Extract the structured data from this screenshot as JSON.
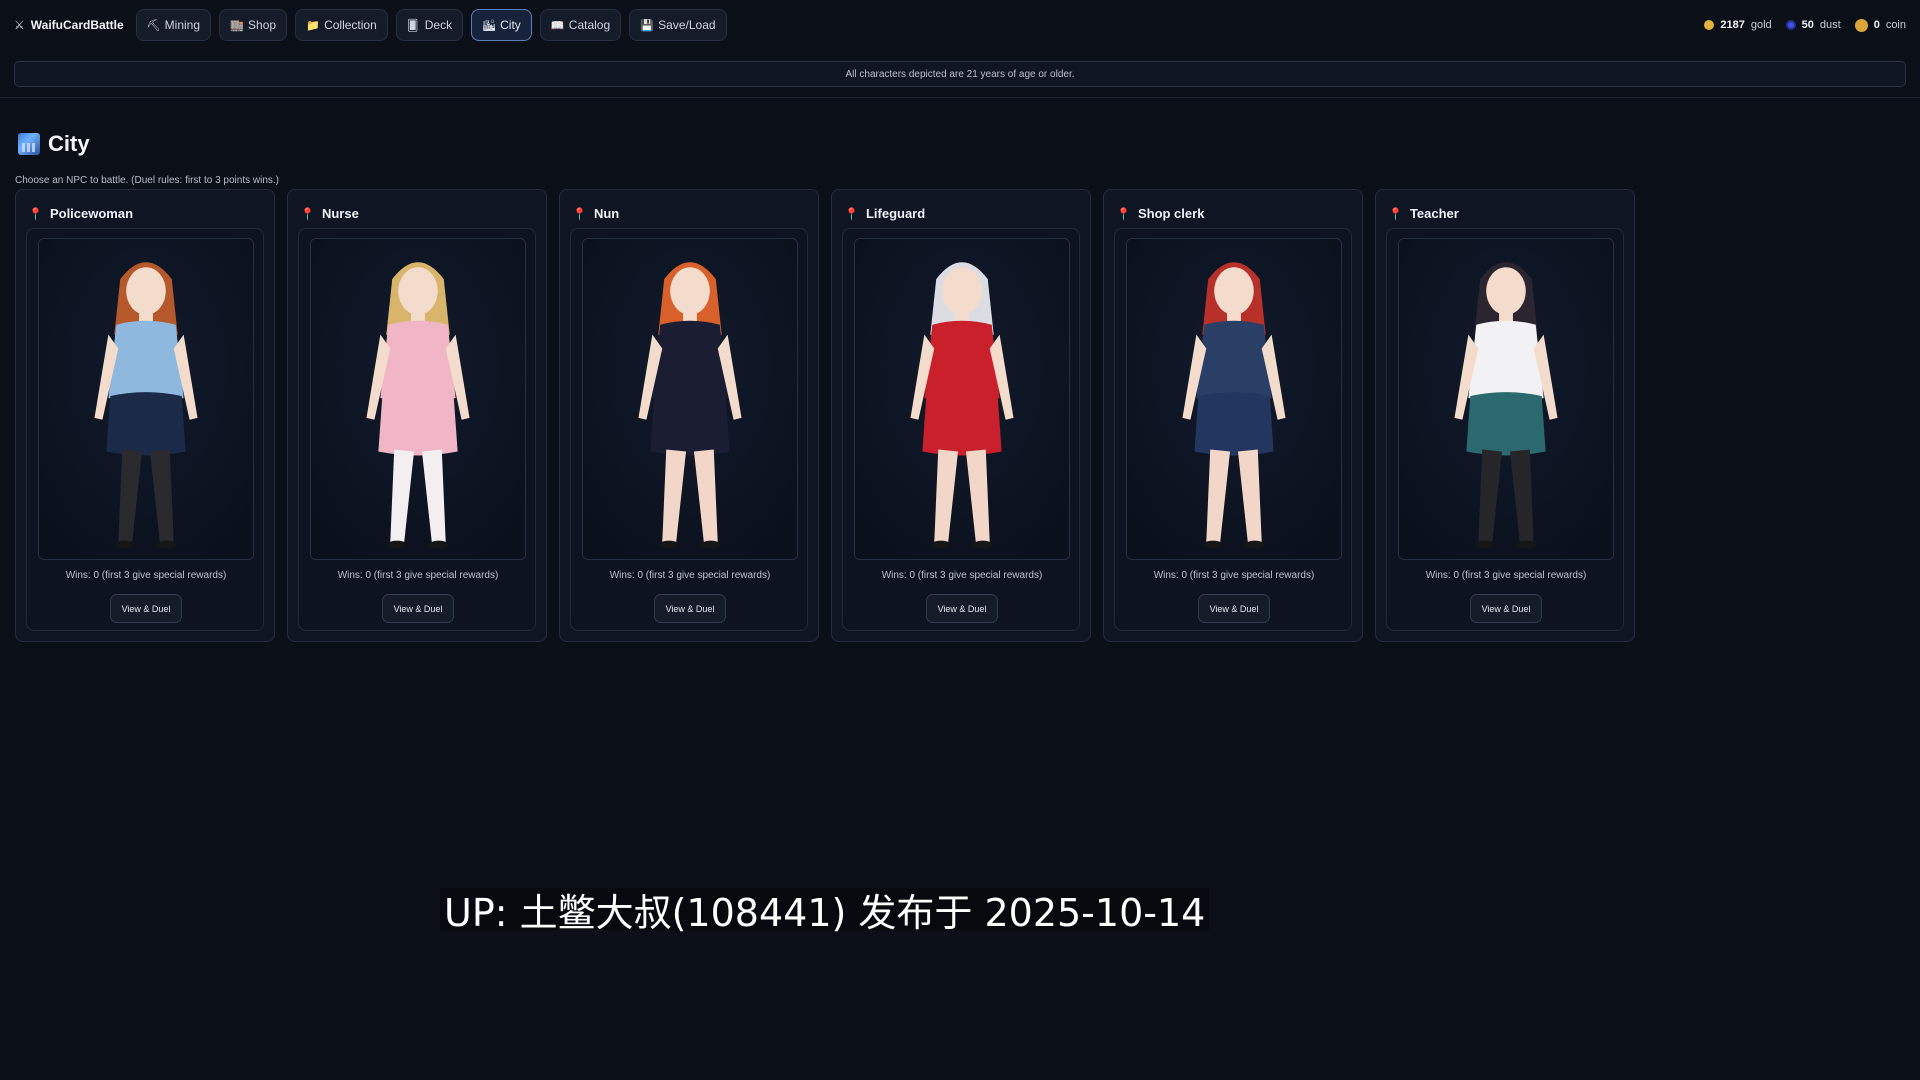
{
  "app": {
    "brand": "WaifuCardBattle",
    "brand_icon": "crossed-swords-icon"
  },
  "nav": [
    {
      "label": "Mining",
      "icon": "pickaxe-icon",
      "glyph": "⛏",
      "active": false
    },
    {
      "label": "Shop",
      "icon": "store-icon",
      "glyph": "🏬",
      "active": false
    },
    {
      "label": "Collection",
      "icon": "folder-icon",
      "glyph": "📁",
      "active": false
    },
    {
      "label": "Deck",
      "icon": "deck-icon",
      "glyph": "🂠",
      "active": false
    },
    {
      "label": "City",
      "icon": "city-icon",
      "glyph": "🏙",
      "active": true
    },
    {
      "label": "Catalog",
      "icon": "catalog-icon",
      "glyph": "📖",
      "active": false
    },
    {
      "label": "Save/Load",
      "icon": "save-icon",
      "glyph": "💾",
      "active": false
    }
  ],
  "currency": {
    "gold": {
      "amount": "2187",
      "label": "gold",
      "color": "#e3b23c"
    },
    "dust": {
      "amount": "50",
      "label": "dust",
      "color": "#3f4ee8"
    },
    "coin": {
      "amount": "0",
      "label": "coin",
      "color": "#d9a63a"
    }
  },
  "notice": "All characters depicted are 21 years of age or older.",
  "page": {
    "title": "City",
    "subtitle": "Choose an NPC to battle. (Duel rules: first to 3 points wins.)"
  },
  "npcs": [
    {
      "name": "Policewoman",
      "wins": "Wins: 0 (first 3 give special rewards)",
      "button": "View & Duel",
      "hair": "#b5582c",
      "top": "#8fb8de",
      "bottom": "#1c2a4a",
      "legs": "#2a2a2e"
    },
    {
      "name": "Nurse",
      "wins": "Wins: 0 (first 3 give special rewards)",
      "button": "View & Duel",
      "hair": "#d8b56a",
      "top": "#f0b6c6",
      "bottom": "#f0b6c6",
      "legs": "#f3eef0"
    },
    {
      "name": "Nun",
      "wins": "Wins: 0 (first 3 give special rewards)",
      "button": "View & Duel",
      "hair": "#d8602a",
      "top": "#1b1d33",
      "bottom": "#1b1d33",
      "legs": "#f2d7c8"
    },
    {
      "name": "Lifeguard",
      "wins": "Wins: 0 (first 3 give special rewards)",
      "button": "View & Duel",
      "hair": "#dcdde3",
      "top": "#c9202c",
      "bottom": "#c9202c",
      "legs": "#f2d7c8"
    },
    {
      "name": "Shop clerk",
      "wins": "Wins: 0 (first 3 give special rewards)",
      "button": "View & Duel",
      "hair": "#b8302a",
      "top": "#2a3f66",
      "bottom": "#223660",
      "legs": "#f2d7c8"
    },
    {
      "name": "Teacher",
      "wins": "Wins: 0 (first 3 give special rewards)",
      "button": "View & Duel",
      "hair": "#2b2530",
      "top": "#f2f2f4",
      "bottom": "#2a6a6e",
      "legs": "#26262a"
    }
  ],
  "overlay": "UP: 土鳖大叔(108441) 发布于 2025-10-14"
}
